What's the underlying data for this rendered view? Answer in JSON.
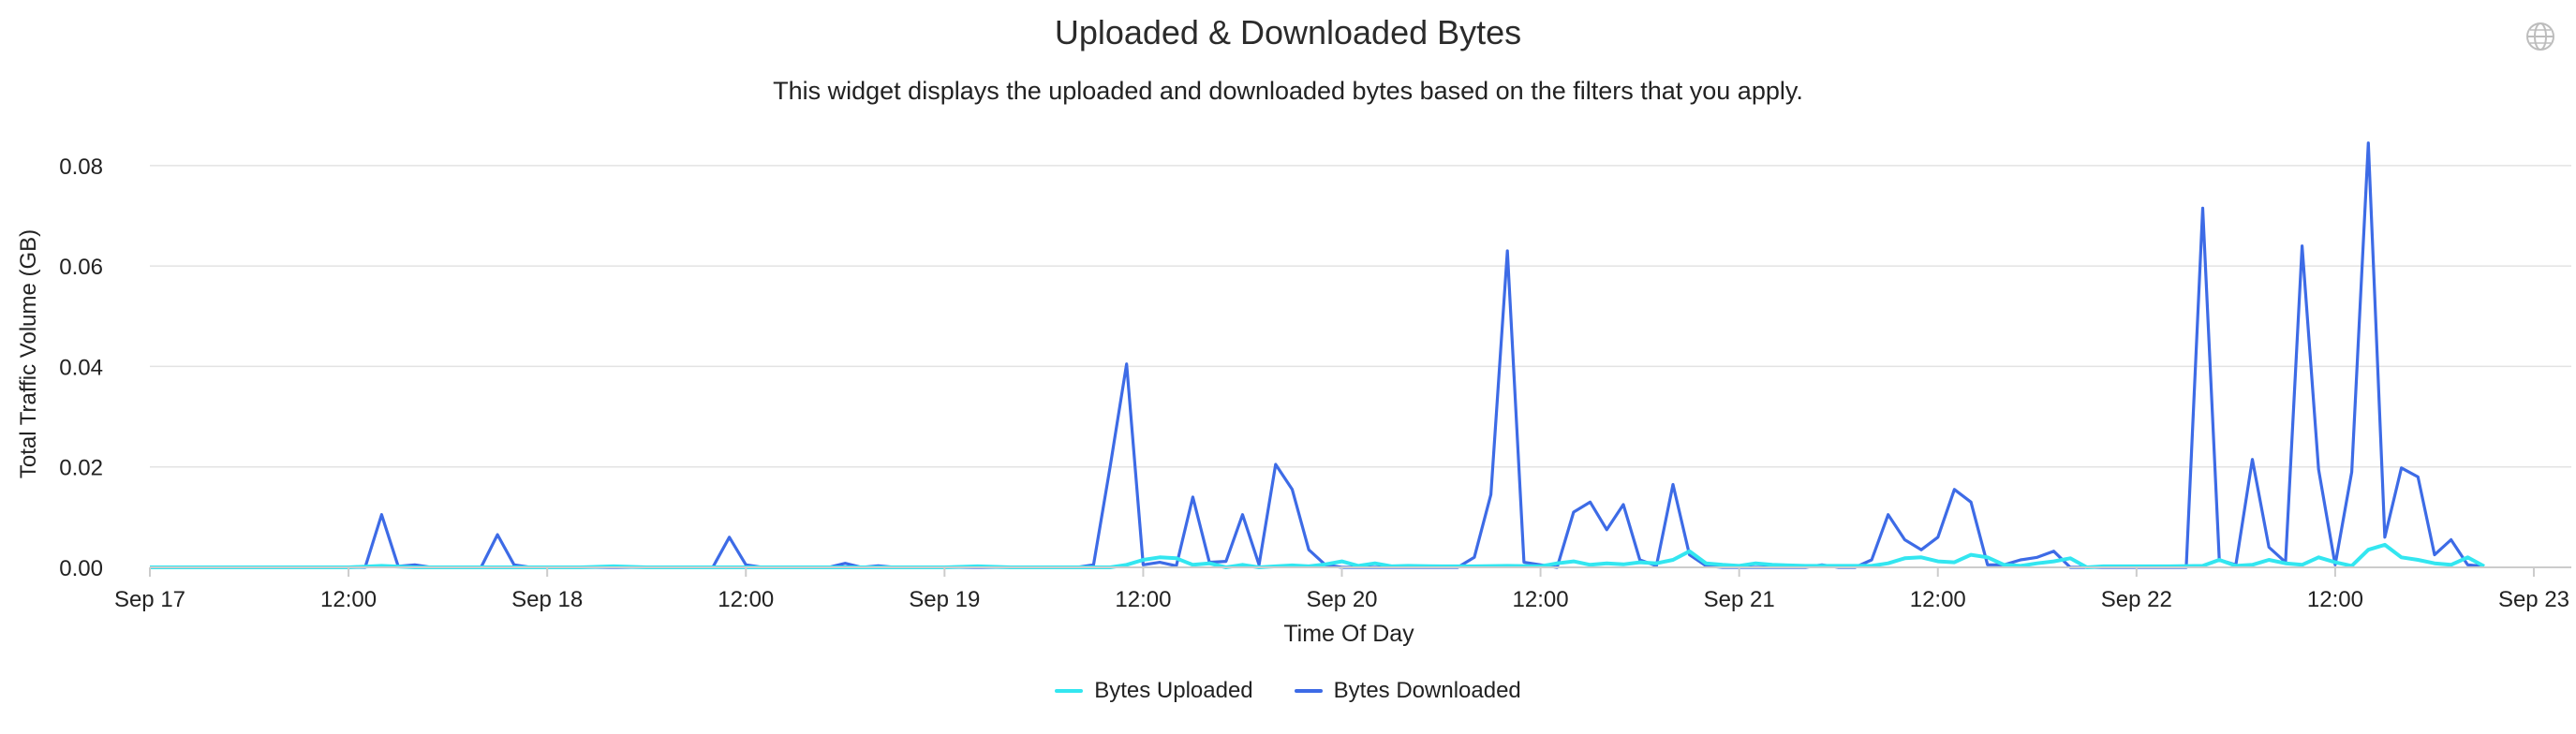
{
  "header": {
    "title": "Uploaded & Downloaded Bytes",
    "subtitle": "This widget displays the uploaded and downloaded bytes based on the filters that you apply.",
    "icon": "globe-icon"
  },
  "colors": {
    "uploaded": "#33e6f0",
    "downloaded": "#3d6be6",
    "grid": "#e3e3e3",
    "axis": "#cccccc"
  },
  "chart_data": {
    "type": "line",
    "title": "Uploaded & Downloaded Bytes",
    "xlabel": "Time Of Day",
    "ylabel": "Total Traffic Volume (GB)",
    "ylim": [
      0,
      0.085
    ],
    "yticks": [
      "0.00",
      "0.02",
      "0.04",
      "0.06",
      "0.08"
    ],
    "xlim": [
      0,
      144
    ],
    "xtick_labels": [
      "Sep 17",
      "12:00",
      "Sep 18",
      "12:00",
      "Sep 19",
      "12:00",
      "Sep 20",
      "12:00",
      "Sep 21",
      "12:00",
      "Sep 22",
      "12:00",
      "Sep 23"
    ],
    "x_unit": "hours since Sep 17 00:00",
    "grid": true,
    "legend": "bottom-center",
    "series": [
      {
        "name": "Bytes Uploaded",
        "points": [
          [
            0,
            0
          ],
          [
            12,
            0
          ],
          [
            14,
            0.0003
          ],
          [
            16,
            0
          ],
          [
            26,
            0
          ],
          [
            28,
            0.0002
          ],
          [
            30,
            0
          ],
          [
            48,
            0
          ],
          [
            50,
            0.0002
          ],
          [
            52,
            0
          ],
          [
            58,
            0
          ],
          [
            59,
            0.0005
          ],
          [
            60,
            0.0015
          ],
          [
            61,
            0.002
          ],
          [
            62,
            0.0018
          ],
          [
            63,
            0.0005
          ],
          [
            64,
            0.0008
          ],
          [
            65,
            0
          ],
          [
            66,
            0.0005
          ],
          [
            67,
            0
          ],
          [
            68,
            0.0002
          ],
          [
            69,
            0.0004
          ],
          [
            70,
            0.0002
          ],
          [
            71,
            0.0006
          ],
          [
            72,
            0.0012
          ],
          [
            73,
            0.0003
          ],
          [
            74,
            0.0008
          ],
          [
            75,
            0.0002
          ],
          [
            76,
            0.0003
          ],
          [
            78,
            0.0002
          ],
          [
            80,
            0.0002
          ],
          [
            82,
            0.0003
          ],
          [
            84,
            0.0002
          ],
          [
            85,
            0.0008
          ],
          [
            86,
            0.0012
          ],
          [
            87,
            0.0005
          ],
          [
            88,
            0.0008
          ],
          [
            89,
            0.0006
          ],
          [
            90,
            0.001
          ],
          [
            91,
            0.0008
          ],
          [
            92,
            0.0015
          ],
          [
            93,
            0.0032
          ],
          [
            94,
            0.0008
          ],
          [
            95,
            0.0005
          ],
          [
            96,
            0.0003
          ],
          [
            97,
            0.0008
          ],
          [
            98,
            0.0005
          ],
          [
            100,
            0.0003
          ],
          [
            102,
            0.0003
          ],
          [
            104,
            0.0003
          ],
          [
            105,
            0.0008
          ],
          [
            106,
            0.0018
          ],
          [
            107,
            0.002
          ],
          [
            108,
            0.0012
          ],
          [
            109,
            0.001
          ],
          [
            110,
            0.0025
          ],
          [
            111,
            0.002
          ],
          [
            112,
            0.0005
          ],
          [
            113,
            0.0003
          ],
          [
            114,
            0.0008
          ],
          [
            115,
            0.0012
          ],
          [
            116,
            0.0018
          ],
          [
            117,
            0
          ],
          [
            118,
            0.0002
          ],
          [
            120,
            0.0002
          ],
          [
            122,
            0.0002
          ],
          [
            124,
            0.0003
          ],
          [
            125,
            0.0015
          ],
          [
            126,
            0.0003
          ],
          [
            127,
            0.0005
          ],
          [
            128,
            0.0015
          ],
          [
            129,
            0.0008
          ],
          [
            130,
            0.0005
          ],
          [
            131,
            0.002
          ],
          [
            132,
            0.001
          ],
          [
            133,
            0.0003
          ],
          [
            134,
            0.0035
          ],
          [
            135,
            0.0045
          ],
          [
            136,
            0.002
          ],
          [
            137,
            0.0015
          ],
          [
            138,
            0.0008
          ],
          [
            139,
            0.0005
          ],
          [
            140,
            0.002
          ],
          [
            141,
            0.0002
          ]
        ]
      },
      {
        "name": "Bytes Downloaded",
        "points": [
          [
            0,
            0
          ],
          [
            13,
            0
          ],
          [
            14,
            0.0105
          ],
          [
            15,
            0.0002
          ],
          [
            16,
            0.0005
          ],
          [
            17,
            0
          ],
          [
            20,
            0
          ],
          [
            21,
            0.0065
          ],
          [
            22,
            0.0005
          ],
          [
            23,
            0
          ],
          [
            34,
            0
          ],
          [
            35,
            0.006
          ],
          [
            36,
            0.0005
          ],
          [
            37,
            0
          ],
          [
            41,
            0
          ],
          [
            42,
            0.0008
          ],
          [
            43,
            0
          ],
          [
            44,
            0.0003
          ],
          [
            45,
            0
          ],
          [
            56,
            0
          ],
          [
            57,
            0.0005
          ],
          [
            58,
            0.02
          ],
          [
            59,
            0.0405
          ],
          [
            60,
            0.0005
          ],
          [
            61,
            0.001
          ],
          [
            62,
            0.0003
          ],
          [
            63,
            0.014
          ],
          [
            64,
            0.001
          ],
          [
            65,
            0.0012
          ],
          [
            66,
            0.0105
          ],
          [
            67,
            0.0005
          ],
          [
            68,
            0.0205
          ],
          [
            69,
            0.0155
          ],
          [
            70,
            0.0035
          ],
          [
            71,
            0.0005
          ],
          [
            72,
            0
          ],
          [
            79,
            0
          ],
          [
            80,
            0.002
          ],
          [
            81,
            0.0145
          ],
          [
            82,
            0.063
          ],
          [
            83,
            0.001
          ],
          [
            84,
            0.0005
          ],
          [
            85,
            0
          ],
          [
            86,
            0.011
          ],
          [
            87,
            0.013
          ],
          [
            88,
            0.0075
          ],
          [
            89,
            0.0125
          ],
          [
            90,
            0.0015
          ],
          [
            91,
            0.0003
          ],
          [
            92,
            0.0165
          ],
          [
            93,
            0.0025
          ],
          [
            94,
            0.0003
          ],
          [
            95,
            0
          ],
          [
            100,
            0
          ],
          [
            101,
            0.0005
          ],
          [
            102,
            0
          ],
          [
            103,
            0
          ],
          [
            104,
            0.0015
          ],
          [
            105,
            0.0105
          ],
          [
            106,
            0.0055
          ],
          [
            107,
            0.0035
          ],
          [
            108,
            0.006
          ],
          [
            109,
            0.0155
          ],
          [
            110,
            0.013
          ],
          [
            111,
            0.0005
          ],
          [
            112,
            0.0005
          ],
          [
            113,
            0.0015
          ],
          [
            114,
            0.002
          ],
          [
            115,
            0.0032
          ],
          [
            116,
            0
          ],
          [
            123,
            0
          ],
          [
            124,
            0.0715
          ],
          [
            125,
            0.0015
          ],
          [
            126,
            0.0005
          ],
          [
            127,
            0.0215
          ],
          [
            128,
            0.004
          ],
          [
            129,
            0.001
          ],
          [
            130,
            0.064
          ],
          [
            131,
            0.0195
          ],
          [
            132,
            0.0005
          ],
          [
            133,
            0.019
          ],
          [
            134,
            0.0845
          ],
          [
            135,
            0.006
          ],
          [
            136,
            0.0198
          ],
          [
            137,
            0.018
          ],
          [
            138,
            0.0025
          ],
          [
            139,
            0.0055
          ],
          [
            140,
            0.0005
          ],
          [
            141,
            0.0002
          ]
        ]
      }
    ]
  }
}
